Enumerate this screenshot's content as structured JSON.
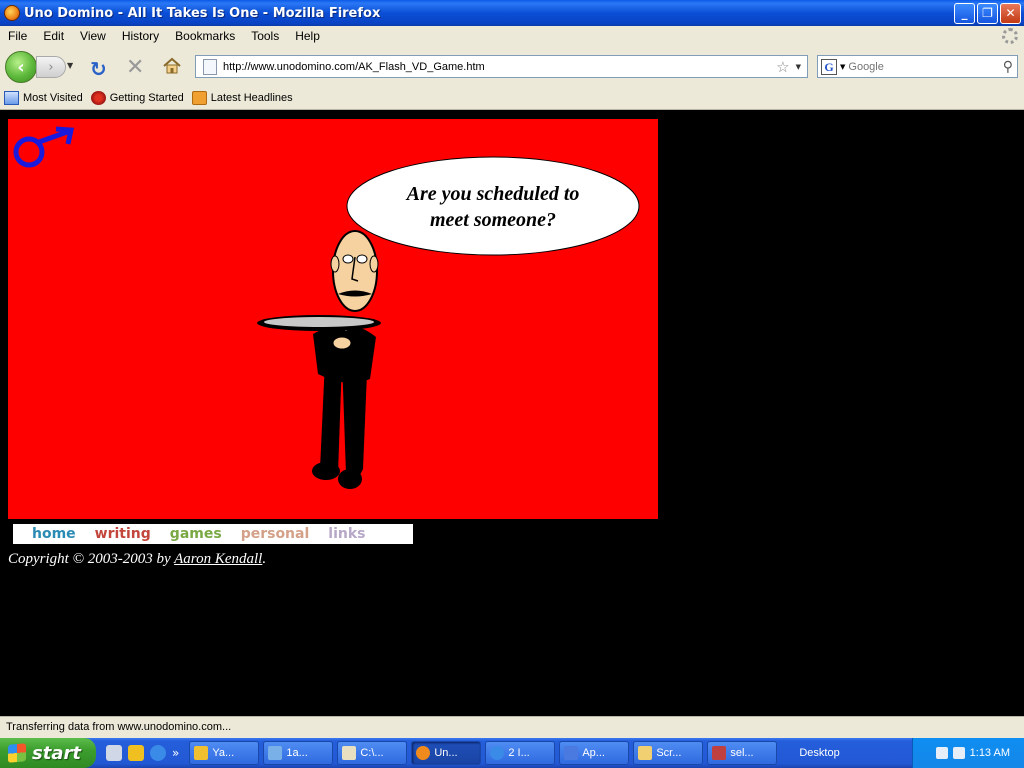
{
  "window": {
    "title": "Uno Domino - All It Takes Is One - Mozilla Firefox",
    "buttons": {
      "minimize": "_",
      "maximize": "❐",
      "close": "✕"
    }
  },
  "menubar": [
    "File",
    "Edit",
    "View",
    "History",
    "Bookmarks",
    "Tools",
    "Help"
  ],
  "navbar": {
    "url": "http://www.unodomino.com/AK_Flash_VD_Game.htm",
    "search_placeholder": "Google",
    "search_engine": "G"
  },
  "bookmarks": [
    "Most Visited",
    "Getting Started",
    "Latest Headlines"
  ],
  "flash": {
    "speech": "Are you scheduled to meet someone?",
    "background_color": "#ff0000",
    "male_symbol_color": "#1a1adc"
  },
  "site_nav": [
    "home",
    "writing",
    "games",
    "personal",
    "links"
  ],
  "copyright": {
    "prefix": "Copyright © 2003-2003 by ",
    "author": "Aaron Kendall",
    "suffix": "."
  },
  "status": "Transferring data from www.unodomino.com...",
  "taskbar": {
    "start_label": "start",
    "tasks": [
      {
        "label": "Ya...",
        "icon_color": "#f0c030",
        "active": false
      },
      {
        "label": "1a...",
        "icon_color": "#7ab0e8",
        "active": false
      },
      {
        "label": "C:\\...",
        "icon_color": "#e8e0c0",
        "active": false
      },
      {
        "label": "Un...",
        "icon_color": "#f08a1c",
        "active": true
      },
      {
        "label": "2 I...",
        "icon_color": "#3a8ae8",
        "active": false
      },
      {
        "label": "Ap...",
        "icon_color": "#4a7ae0",
        "active": false
      },
      {
        "label": "Scr...",
        "icon_color": "#f0d070",
        "active": false
      },
      {
        "label": "sel...",
        "icon_color": "#c04040",
        "active": false
      }
    ],
    "desktop_label": "Desktop",
    "clock": "1:13 AM"
  }
}
